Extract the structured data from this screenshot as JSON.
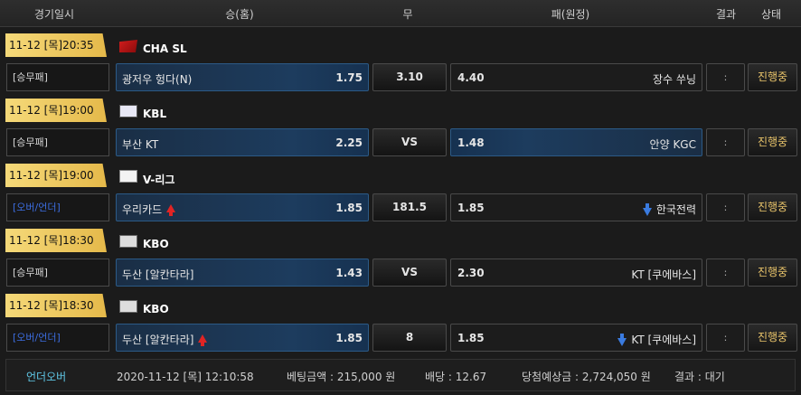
{
  "header": {
    "col_time": "경기일시",
    "col_home": "승(홈)",
    "col_draw": "무",
    "col_away": "패(원정)",
    "col_result": "결과",
    "col_status": "상태"
  },
  "games": [
    {
      "datetime": "11-12 [목]20:35",
      "league": "CHA SL",
      "logo": "flag-icon",
      "bet_type": "[승무패]",
      "home_team": "광저우 헝다(N)",
      "home_odds": "1.75",
      "home_arrow": "",
      "draw": "3.10",
      "away_odds": "4.40",
      "away_team": "장수 쑤닝",
      "away_arrow": "",
      "away_selected": false,
      "result": ":",
      "status": "진행중"
    },
    {
      "datetime": "11-12 [목]19:00",
      "league": "KBL",
      "logo": "kbl-logo-icon",
      "bet_type": "[승무패]",
      "home_team": "부산 KT",
      "home_odds": "2.25",
      "home_arrow": "",
      "draw": "VS",
      "away_odds": "1.48",
      "away_team": "안양 KGC",
      "away_arrow": "",
      "away_selected": true,
      "result": ":",
      "status": "진행중"
    },
    {
      "datetime": "11-12 [목]19:00",
      "league": "V-리그",
      "logo": "vleague-logo-icon",
      "bet_type": "[오버/언더]",
      "home_team": "우리카드",
      "home_odds": "1.85",
      "home_arrow": "up",
      "draw": "181.5",
      "away_odds": "1.85",
      "away_team": "한국전력",
      "away_arrow": "down",
      "away_selected": false,
      "result": ":",
      "status": "진행중"
    },
    {
      "datetime": "11-12 [목]18:30",
      "league": "KBO",
      "logo": "kbo-logo-icon",
      "bet_type": "[승무패]",
      "home_team": "두산 [알칸타라]",
      "home_odds": "1.43",
      "home_arrow": "",
      "draw": "VS",
      "away_odds": "2.30",
      "away_team": "KT [쿠에바스]",
      "away_arrow": "",
      "away_selected": false,
      "result": ":",
      "status": "진행중"
    },
    {
      "datetime": "11-12 [목]18:30",
      "league": "KBO",
      "logo": "kbo-logo-icon",
      "bet_type": "[오버/언더]",
      "home_team": "두산 [알칸타라]",
      "home_odds": "1.85",
      "home_arrow": "up",
      "draw": "8",
      "away_odds": "1.85",
      "away_team": "KT [쿠에바스]",
      "away_arrow": "down",
      "away_selected": false,
      "result": ":",
      "status": "진행중"
    }
  ],
  "footer": {
    "type": "언더오버",
    "datetime": "2020-11-12 [목] 12:10:58",
    "bet_amount": "베팅금액 : 215,000 원",
    "odds": "배당 : 12.67",
    "expected_win": "당첨예상금 : 2,724,050 원",
    "result": "결과 : 대기"
  }
}
